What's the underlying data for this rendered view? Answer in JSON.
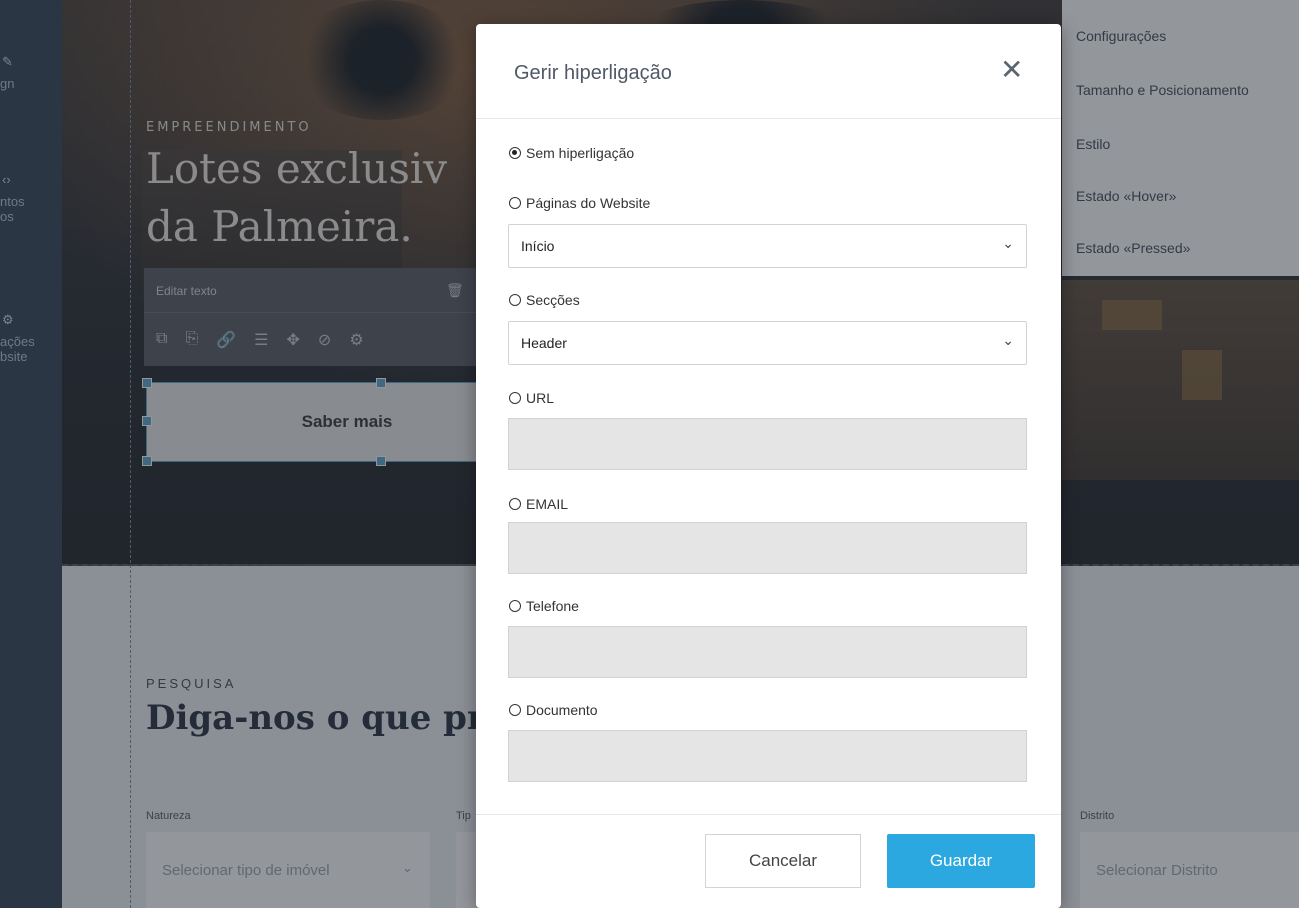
{
  "sidebar": {
    "items": [
      {
        "icon": "pencil-icon",
        "label": "gn"
      },
      {
        "icon": "code-icon",
        "label": "ntos\nos"
      },
      {
        "icon": "settings-icon",
        "label": "ações\nbsite"
      }
    ]
  },
  "hero": {
    "eyebrow": "EMPREENDIMENTO",
    "title": "Lotes exclusiv\nda Palmeira.",
    "toolbar": {
      "title": "Editar texto",
      "icons": [
        "copy-icon",
        "duplicate-icon",
        "link-icon",
        "database-icon",
        "move-icon",
        "hide-icon",
        "gear-icon"
      ]
    },
    "button_label": "Saber mais"
  },
  "search_section": {
    "eyebrow": "PESQUISA",
    "title": "Diga-nos o que pr",
    "fields": [
      {
        "label": "Natureza",
        "placeholder": "Selecionar tipo de imóvel"
      },
      {
        "label": "Tip",
        "placeholder": ""
      },
      {
        "label": "Distrito",
        "placeholder": "Selecionar Distrito"
      }
    ]
  },
  "right_panel": {
    "items": [
      "Configurações",
      "Tamanho e Posicionamento",
      "Estilo",
      "Estado «Hover»",
      "Estado «Pressed»"
    ]
  },
  "modal": {
    "title": "Gerir hiperligação",
    "close_glyph": "✕",
    "options": {
      "none": "Sem hiperligação",
      "pages": "Páginas do Website",
      "pages_value": "Início",
      "sections": "Secções",
      "sections_value": "Header",
      "url": "URL",
      "email": "EMAIL",
      "phone": "Telefone",
      "document": "Documento"
    },
    "selected_option": "none",
    "cancel_label": "Cancelar",
    "save_label": "Guardar"
  },
  "colors": {
    "primary_button": "#2aa8df",
    "sidebar": "#2c3e50"
  }
}
